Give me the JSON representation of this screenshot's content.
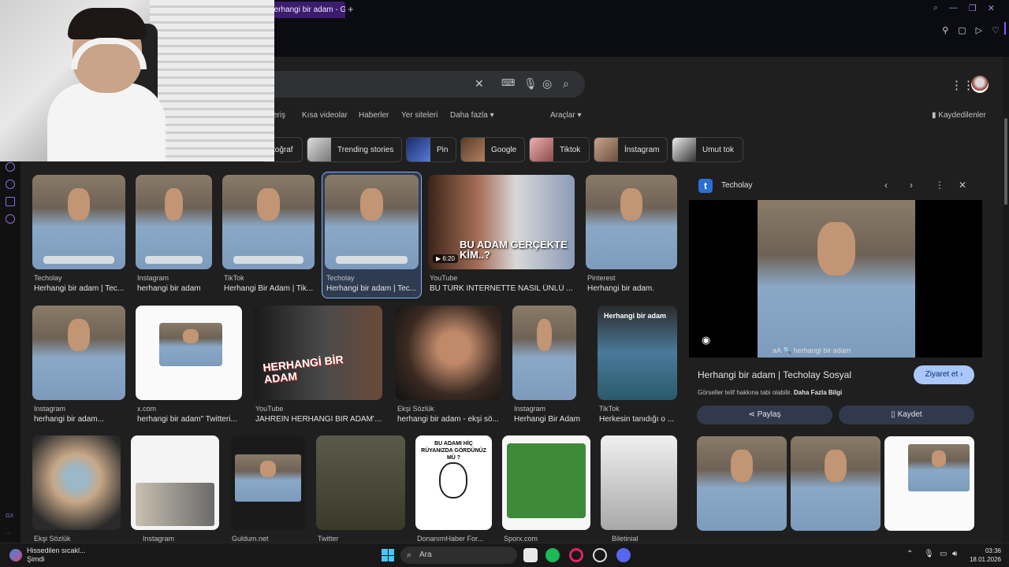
{
  "browser": {
    "tab_title": "herhangi bir adam - Google",
    "new_tab": "+"
  },
  "nav": {
    "items": [
      "eriş",
      "Kısa videolar",
      "Haberler",
      "Yer siteleri",
      "Daha fazla ▾",
      "Araçlar ▾"
    ],
    "saved": "Kaydedilenler"
  },
  "chips": [
    {
      "label": "toğraf"
    },
    {
      "label": "Trending stories"
    },
    {
      "label": "Pin"
    },
    {
      "label": "Google"
    },
    {
      "label": "Tiktok"
    },
    {
      "label": "İnstagram"
    },
    {
      "label": "Umut tok"
    }
  ],
  "results_row1": [
    {
      "source": "Techolay",
      "title": "Herhangi bir adam | Tec..."
    },
    {
      "source": "Instagram",
      "title": "herhangi bir adam"
    },
    {
      "source": "TikTok",
      "title": "Herhangi Bir Adam | Tik..."
    },
    {
      "source": "Techolay",
      "title": "Herhangi bir adam | Tec..."
    },
    {
      "source": "YouTube",
      "title": "BU TÜRK İNTERNETTE NASIL ÜNLÜ ...",
      "duration": "6:20",
      "overlay": "BU ADAM GERÇEKTE KİM..?"
    },
    {
      "source": "Pinterest",
      "title": "Herhangi bir adam."
    }
  ],
  "results_row2": [
    {
      "source": "Instagram",
      "title": "herhangi bir adam..."
    },
    {
      "source": "x.com",
      "title": "herhangi bir adam\" Twitteri..."
    },
    {
      "source": "YouTube",
      "title": "JAHREİN HERHANGİ BİR ADAM'I ...",
      "overlay": "HERHANGİ BİR ADAM"
    },
    {
      "source": "Ekşi Sözlük",
      "title": "herhangi bir adam - ekşi sö..."
    },
    {
      "source": "Instagram",
      "title": "Herhangi Bir Adam"
    },
    {
      "source": "TikTok",
      "title": "Herkesin tanıdığı o ...",
      "overlay": "Herhangi bir adam"
    }
  ],
  "results_row3": [
    {
      "source": "Ekşi Sözlük"
    },
    {
      "source": "Instagram"
    },
    {
      "source": "Guldum.net"
    },
    {
      "source": "Twitter"
    },
    {
      "source": "DonanımHaber For...",
      "overlay": "BU ADAMI HİÇ RÜYANIZDA GÖRDÜNÜZ MÜ ?"
    },
    {
      "source": "Sporx.com"
    },
    {
      "source": "Biletinial"
    }
  ],
  "panel": {
    "site": "Techolay",
    "title": "Herhangi bir adam | Techolay Sosyal",
    "visit": "Ziyaret et  ›",
    "copyright": "Görseller telif hakkına tabi olabilir.",
    "more_info": "Daha Fazla Bilgi",
    "share": "Paylaş",
    "save": "Kaydet",
    "image_caption": "aA  🔍 herhangi bir adam"
  },
  "taskbar": {
    "weather_line1": "Hissedilen sıcakl...",
    "weather_line2": "Şimdi",
    "search": "Ara",
    "time": "03:36",
    "date": "18.01.2026"
  },
  "rail": {
    "label": "GX"
  }
}
